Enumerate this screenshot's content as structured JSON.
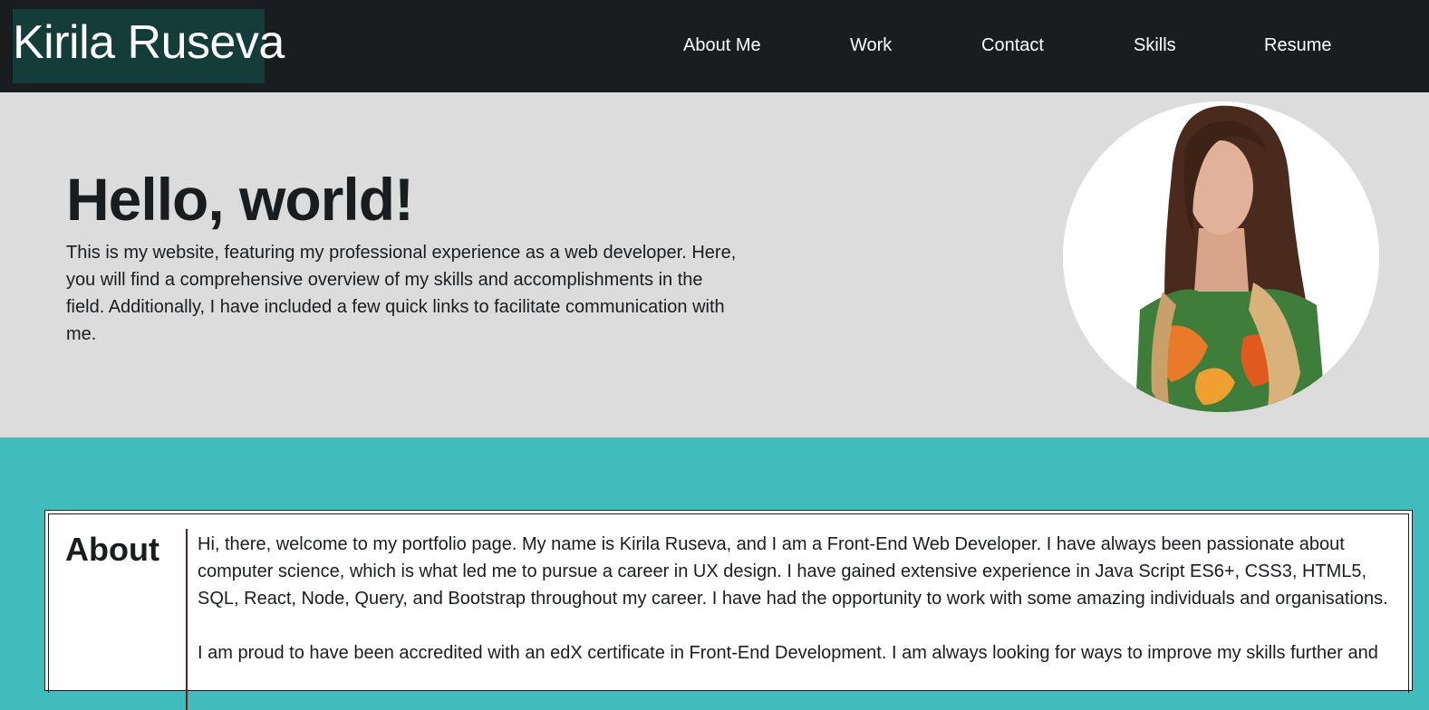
{
  "nav": {
    "brand": "Kirila Ruseva",
    "links": [
      "About Me",
      "Work",
      "Contact",
      "Skills",
      "Resume"
    ]
  },
  "hero": {
    "title": "Hello, world!",
    "text": "This is my website, featuring my professional experience as a web developer. Here, you will find a comprehensive overview of my skills and accomplishments in the field. Additionally, I have included a few quick links to facilitate communication with me."
  },
  "about": {
    "heading": "About",
    "paragraphs": [
      "Hi, there, welcome to my portfolio page. My name is Kirila Ruseva, and I am a Front-End Web Developer. I have always been passionate about computer science, which is what led me to pursue a career in UX design. I have gained extensive experience in Java Script ES6+, CSS3, HTML5, SQL, React, Node, Query, and Bootstrap throughout my career. I have had the opportunity to work with some amazing individuals and organisations.",
      "I am proud to have been accredited with an edX certificate in Front-End Development. I am always looking for ways to improve my skills further and"
    ]
  },
  "colors": {
    "navbar": "#1a1d20",
    "brand_bg": "#143c38",
    "hero_bg": "#dcdcdc",
    "section_bg": "#40bcbc",
    "divider": "#6b1a1a"
  }
}
